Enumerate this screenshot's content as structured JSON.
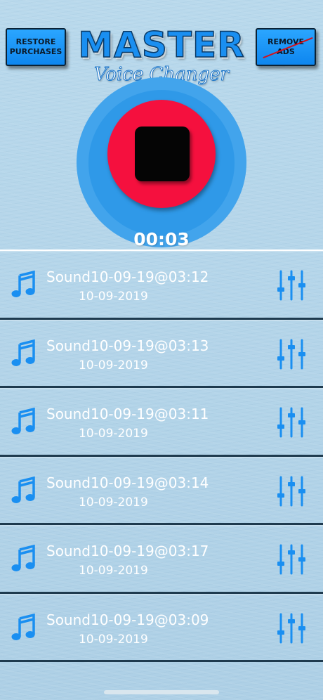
{
  "header": {
    "restore_label": "RESTORE PURCHASES",
    "remove_ads_label": "REMOVE ADS",
    "logo_title": "MASTER",
    "logo_subtitle": "Voice Changer"
  },
  "recorder": {
    "state": "recording",
    "timer": "00:03",
    "button_color": "#f5103e",
    "ring_color": "#42a4ec"
  },
  "recordings": [
    {
      "title": "Sound10-09-19@03:12",
      "date": "10-09-2019"
    },
    {
      "title": "Sound10-09-19@03:13",
      "date": "10-09-2019"
    },
    {
      "title": "Sound10-09-19@03:11",
      "date": "10-09-2019"
    },
    {
      "title": "Sound10-09-19@03:14",
      "date": "10-09-2019"
    },
    {
      "title": "Sound10-09-19@03:17",
      "date": "10-09-2019"
    },
    {
      "title": "Sound10-09-19@03:09",
      "date": "10-09-2019"
    }
  ],
  "icons": {
    "row_left": "music-note-icon",
    "row_right": "equalizer-sliders-icon"
  },
  "colors": {
    "accent_blue": "#1a8ff1",
    "text": "#ffffff"
  }
}
